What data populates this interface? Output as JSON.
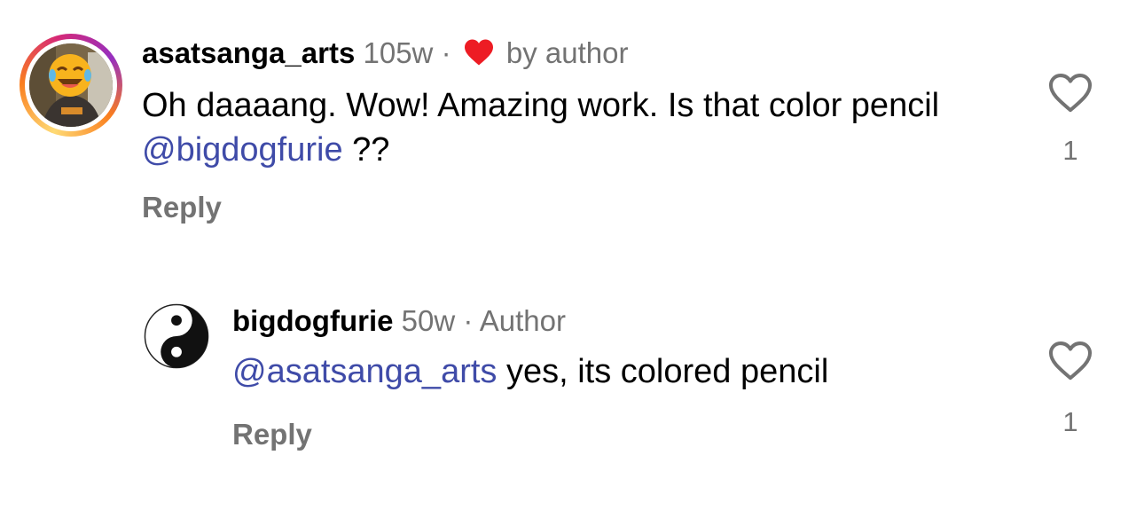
{
  "comments": [
    {
      "username": "asatsanga_arts",
      "time": "105w",
      "separator": "·",
      "tag": "by author",
      "liked_by_author_icon": "heart-filled-icon",
      "text_parts": [
        "Oh daaaang. Wow! Amazing work. Is that color pencil ",
        "@bigdogfurie",
        " ??"
      ],
      "reply_label": "Reply",
      "like_icon": "heart-outline-icon",
      "like_count": "1",
      "avatar_ring_colors": [
        "#feda75",
        "#fa7e1e",
        "#d62976",
        "#962fbf"
      ]
    },
    {
      "username": "bigdogfurie",
      "time": "50w",
      "separator": "·",
      "tag": "Author",
      "avatar_icon": "yin-yang-icon",
      "text_parts": [
        "@asatsanga_arts",
        " yes, its colored pencil"
      ],
      "reply_label": "Reply",
      "like_icon": "heart-outline-icon",
      "like_count": "1"
    }
  ],
  "colors": {
    "mention": "#3f4ba8",
    "muted": "#737373",
    "heart_red": "#ed1c24"
  }
}
